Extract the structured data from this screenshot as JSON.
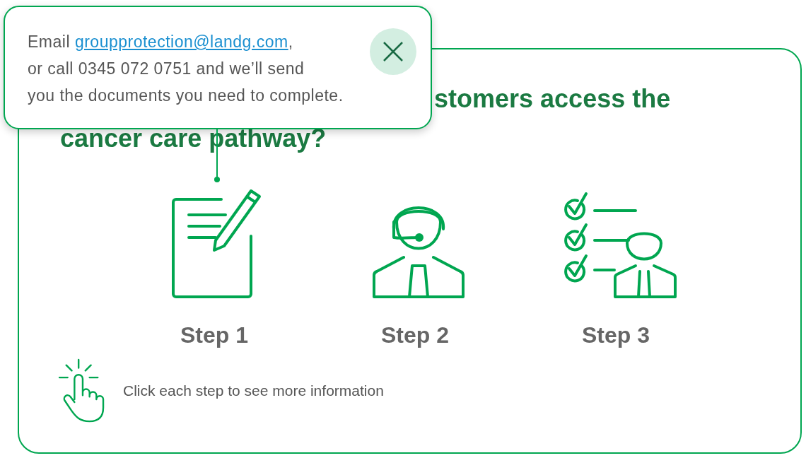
{
  "tooltip": {
    "text_before": "Email ",
    "link": "groupprotection@landg.com",
    "link_after": ",",
    "lines": [
      "or call 0345 072 0751 and we’ll send",
      "you the documents you need to complete."
    ]
  },
  "heading_lines": [
    "stomers access the",
    "cancer care pathway?"
  ],
  "steps": [
    {
      "label": "Step 1",
      "kind": "document"
    },
    {
      "label": "Step 2",
      "kind": "agent"
    },
    {
      "label": "Step 3",
      "kind": "checklist"
    }
  ],
  "hint": "Click each step to see more information"
}
